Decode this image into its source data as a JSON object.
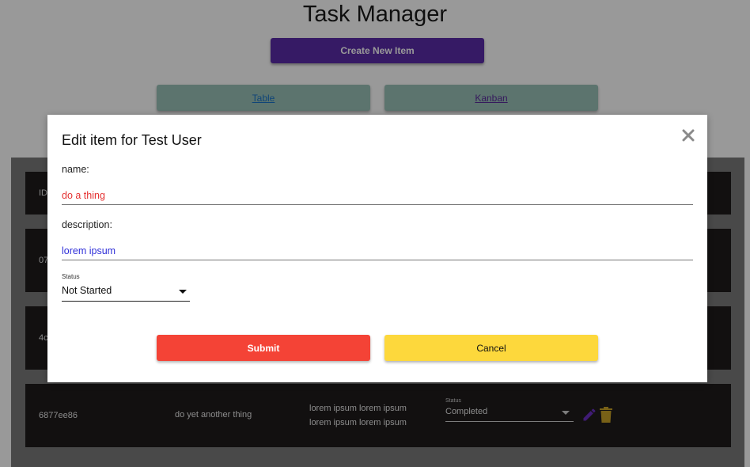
{
  "header": {
    "title": "Task Manager",
    "create_label": "Create New Item"
  },
  "views": {
    "table_label": "Table",
    "kanban_label": "Kanban"
  },
  "table": {
    "header_partial": "ID",
    "rows": [
      {
        "id_partial": "07"
      },
      {
        "id_partial": "4c"
      },
      {
        "id": "6877ee86",
        "name": "do yet another thing",
        "description_line1": "lorem ipsum lorem ipsum",
        "description_line2": "lorem ipsum lorem ipsum",
        "status_label": "Status",
        "status_value": "Completed"
      }
    ]
  },
  "modal": {
    "title": "Edit item for Test User",
    "name_label": "name:",
    "name_value": "do a thing",
    "description_label": "description:",
    "description_value": "lorem ipsum",
    "status_label": "Status",
    "status_value": "Not Started",
    "submit_label": "Submit",
    "cancel_label": "Cancel"
  },
  "colors": {
    "create_button": "#5a2ca8",
    "view_button": "#99c1b8",
    "row_background": "#1e1b1c",
    "submit_button": "#f44336",
    "cancel_button": "#fdd83c",
    "name_text": "#e53232",
    "description_text": "#2f2fd8",
    "edit_icon": "#6b2fc4",
    "delete_icon": "#c9a227"
  },
  "icons": {
    "close": "close-icon",
    "edit": "pencil-icon",
    "delete": "trash-icon"
  }
}
